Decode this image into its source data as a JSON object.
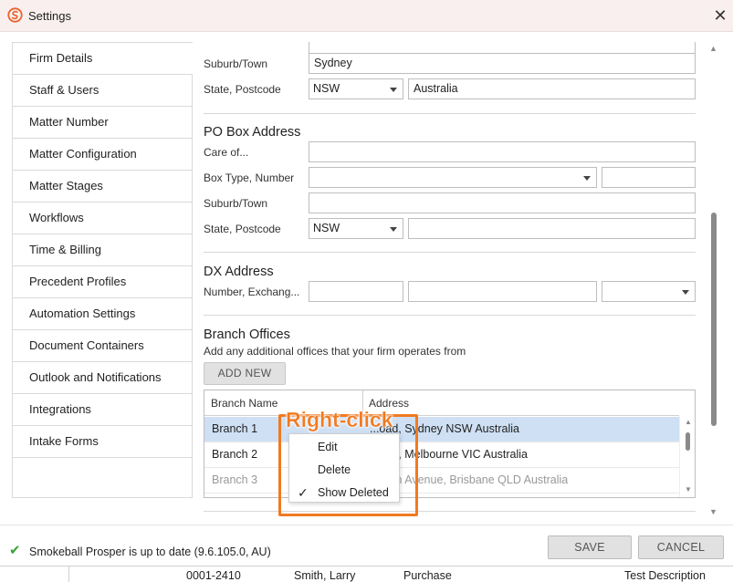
{
  "window": {
    "title": "Settings",
    "icon": "smokeball-logo",
    "close_icon": "close-icon"
  },
  "sidebar": {
    "items": [
      {
        "label": "Firm Details",
        "active": true
      },
      {
        "label": "Staff & Users"
      },
      {
        "label": "Matter Number"
      },
      {
        "label": "Matter Configuration"
      },
      {
        "label": "Matter Stages"
      },
      {
        "label": "Workflows"
      },
      {
        "label": "Time & Billing"
      },
      {
        "label": "Precedent Profiles"
      },
      {
        "label": "Automation Settings"
      },
      {
        "label": "Document Containers"
      },
      {
        "label": "Outlook and Notifications"
      },
      {
        "label": "Integrations"
      },
      {
        "label": "Intake Forms"
      }
    ]
  },
  "street_address": {
    "suburb_label": "Suburb/Town",
    "suburb_value": "Sydney",
    "state_postcode_label": "State, Postcode",
    "state_value": "NSW",
    "country_value": "Australia"
  },
  "po_box": {
    "title": "PO Box Address",
    "care_of_label": "Care of...",
    "box_type_label": "Box Type, Number",
    "suburb_label": "Suburb/Town",
    "state_postcode_label": "State, Postcode",
    "state_value": "NSW"
  },
  "dx": {
    "title": "DX Address",
    "number_label": "Number, Exchang..."
  },
  "branches": {
    "title": "Branch Offices",
    "subtitle": "Add any additional offices that your firm operates from",
    "add_button": "ADD NEW",
    "columns": [
      "Branch Name",
      "Address"
    ],
    "rows": [
      {
        "name": "Branch 1",
        "address": "...oad, Sydney NSW Australia",
        "selected": true
      },
      {
        "name": "Branch 2",
        "address": "...oad, Melbourne VIC Australia"
      },
      {
        "name": "Branch 3",
        "address": "...roon Avenue, Brisbane QLD Australia",
        "deleted": true
      }
    ]
  },
  "context_menu": {
    "items": [
      {
        "label": "Edit"
      },
      {
        "label": "Delete"
      },
      {
        "label": "Show Deleted",
        "checked": true
      }
    ]
  },
  "annotation": {
    "text": "Right-click",
    "color": "#f07a20"
  },
  "footer": {
    "status": "Smokeball Prosper is up to date (9.6.105.0, AU)",
    "status_icon": "checkmark-icon",
    "save": "SAVE",
    "cancel": "CANCEL"
  },
  "background_app": {
    "cells": [
      "0001-2410",
      "Smith, Larry",
      "Purchase",
      "Test Description"
    ]
  }
}
